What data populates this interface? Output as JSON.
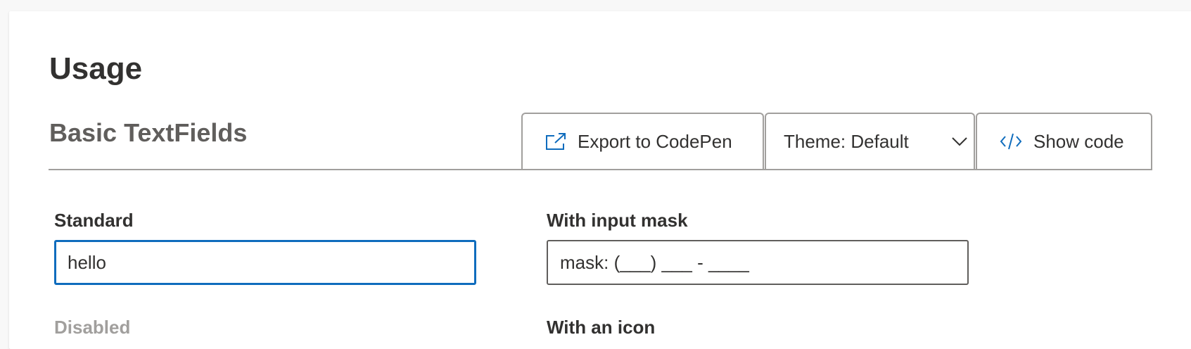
{
  "page": {
    "title": "Usage"
  },
  "section": {
    "title": "Basic TextFields"
  },
  "toolbar": {
    "export_label": "Export to CodePen",
    "export_icon": "external-link-icon",
    "theme_label": "Theme: Default",
    "theme_icon": "chevron-down-icon",
    "code_label": "Show code",
    "code_icon": "code-icon",
    "accent_color": "#0f6cbd"
  },
  "fields": {
    "standard": {
      "label": "Standard",
      "value": "hello",
      "state": "focused",
      "focus_border_color": "#0f6cbd"
    },
    "mask": {
      "label": "With input mask",
      "value": "mask: (___) ___ - ____"
    },
    "disabled": {
      "label": "Disabled",
      "label_color": "#a19f9d"
    },
    "icon": {
      "label": "With an icon"
    }
  }
}
